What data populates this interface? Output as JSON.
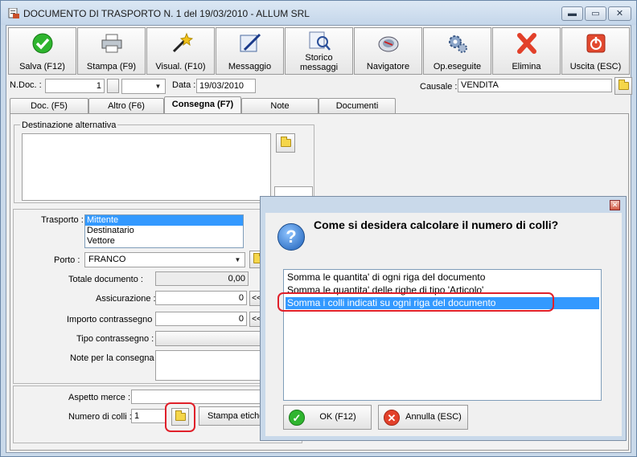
{
  "window": {
    "title": "DOCUMENTO DI TRASPORTO N. 1  del 19/03/2010 - ALLUM SRL",
    "min_glyph": "▬",
    "max_glyph": "▭",
    "close_glyph": "✕"
  },
  "toolbar": [
    {
      "label": "Salva (F12)",
      "icon": "check-icon"
    },
    {
      "label": "Stampa (F9)",
      "icon": "printer-icon"
    },
    {
      "label": "Visual. (F10)",
      "icon": "magic-wand-icon"
    },
    {
      "label": "Messaggio",
      "icon": "message-pen-icon"
    },
    {
      "label": "Storico messaggi",
      "icon": "message-history-icon"
    },
    {
      "label": "Navigatore",
      "icon": "navigator-icon"
    },
    {
      "label": "Op.eseguite",
      "icon": "gears-icon"
    },
    {
      "label": "Elimina",
      "icon": "delete-x-icon"
    },
    {
      "label": "Uscita (ESC)",
      "icon": "exit-icon"
    }
  ],
  "header": {
    "ndoc_label": "N.Doc. :",
    "ndoc_value": "1",
    "data_label": "Data :",
    "data_value": "19/03/2010",
    "causale_label": "Causale :",
    "causale_value": "VENDITA"
  },
  "tabs": [
    "Doc. (F5)",
    "Altro (F6)",
    "Consegna (F7)",
    "Note",
    "Documenti"
  ],
  "active_tab": 2,
  "consegna": {
    "destinazione_label": "Destinazione alternativa",
    "trasporto_label": "Trasporto :",
    "trasporto_options": [
      "Mittente",
      "Destinatario",
      "Vettore"
    ],
    "trasporto_selected": 0,
    "porto_label": "Porto :",
    "porto_value": "FRANCO",
    "totale_label": "Totale documento :",
    "totale_value": "0,00",
    "assicurazione_label": "Assicurazione :",
    "assicurazione_value": "0",
    "contrassegno_label": "Importo contrassegno :",
    "contrassegno_value": "0",
    "tipo_contrassegno_label": "Tipo contrassegno :",
    "note_consegna_label": "Note per la consegna",
    "aspetto_label": "Aspetto merce :",
    "colli_label": "Numero di colli :",
    "colli_value": "1",
    "stampa_etichette_label": "Stampa etiche",
    "arrow_label": "<<"
  },
  "dialog": {
    "question": "Come si desidera calcolare il numero di colli?",
    "options": [
      "Somma le quantita' di ogni riga del documento",
      "Somma le quantita' delle righe di tipo 'Articolo'",
      "Somma i colli indicati su ogni riga del documento"
    ],
    "selected": 2,
    "ok_label": "OK (F12)",
    "cancel_label": "Annulla (ESC)",
    "close_glyph": "✕",
    "question_glyph": "?"
  },
  "colors": {
    "selection": "#3399ff",
    "highlight_ring": "#e0202a",
    "title_bar": "#c9d9ea"
  }
}
